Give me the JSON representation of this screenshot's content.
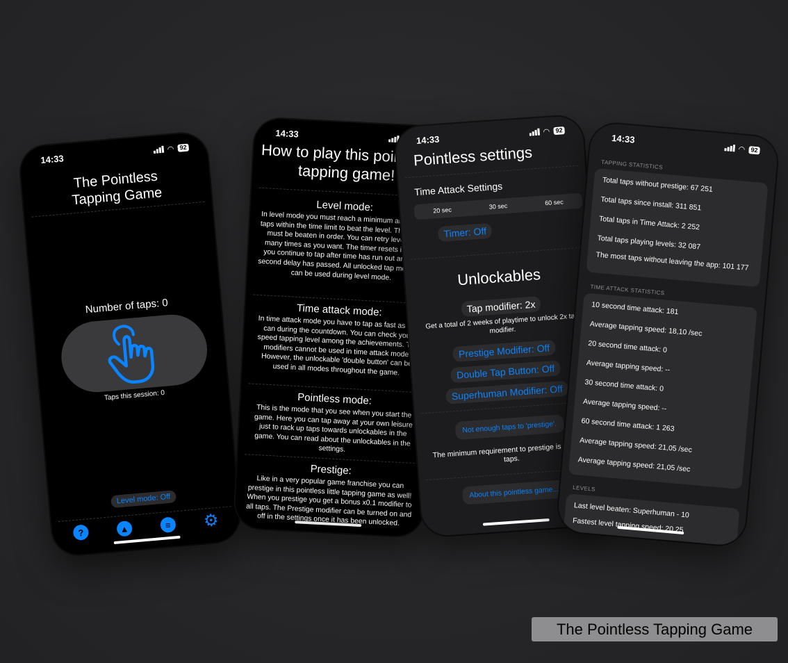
{
  "status": {
    "time": "14:33",
    "battery": "92"
  },
  "phone1": {
    "title_line1": "The Pointless",
    "title_line2": "Tapping Game",
    "taps_label": "Number of taps: 0",
    "session_label": "Taps this session: 0",
    "level_mode": "Level mode: Off",
    "tabs": [
      "help-icon",
      "thumbs-up-icon",
      "list-icon",
      "gear-icon"
    ]
  },
  "phone2": {
    "title_line1": "How to play this pointless",
    "title_line2": "tapping game!",
    "sections": [
      {
        "heading": "Level mode:",
        "body": "In level mode you must reach a minimum amount of taps within the time limit to beat the level. The levels must be beaten in order. You can retry levels as many times as you want. The timer resets itself if you continue to tap after time has run out and a 3 second delay has passed. All unlocked tap modifiers can be used during level mode."
      },
      {
        "heading": "Time attack mode:",
        "body": "In time attack mode you have to tap as fast as you can during the countdown. You can check your speed tapping level among the achievements. Tap modifiers cannot be used in time attack mode. However, the unlockable 'double button' can be used in all modes throughout the game."
      },
      {
        "heading": "Pointless mode:",
        "body": "This is the mode that you see when you start the game. Here you can tap away at your own leisure just to rack up taps towards unlockables in the game. You can read about the unlockables in the settings."
      },
      {
        "heading": "Prestige:",
        "body": "Like in a very popular game franchise you can prestige in this pointless little tapping game as well! When you prestige you get a bonus x0.1 modifier to all taps. The Prestige modifier can be turned on and off in the settings once it has been unlocked."
      }
    ]
  },
  "phone3": {
    "title": "Pointless settings",
    "time_attack_label": "Time Attack Settings",
    "segments": [
      "20 sec",
      "30 sec",
      "60 sec"
    ],
    "timer": "Timer: Off",
    "unlockables_title": "Unlockables",
    "tap_modifier": "Tap modifier: 2x",
    "tap_modifier_note": "Get a total of 2 weeks of playtime to unlock 2x tap modifier.",
    "prestige_modifier": "Prestige Modifier: Off",
    "double_tap": "Double Tap Button: Off",
    "superhuman": "Superhuman Modifier: Off",
    "prestige_button": "Not enough taps to 'prestige'.",
    "prestige_requirement": "The minimum requirement to prestige is 100,000 taps.",
    "about_button": "About this pointless game..."
  },
  "phone4": {
    "tapping_header": "TAPPING STATISTICS",
    "tapping_rows": [
      "Total taps without prestige: 67 251",
      "Total taps since install: 311 851",
      "Total taps in Time Attack: 2 252",
      "Total taps playing levels: 32 087",
      "The most taps without leaving the app: 101 177"
    ],
    "time_attack_header": "TIME ATTACK STATISTICS",
    "time_attack_rows": [
      "10 second time attack: 181",
      "Average tapping speed: 18,10 /sec",
      "20 second time attack: 0",
      "Average tapping speed: --",
      "30 second time attack: 0",
      "Average tapping speed: --",
      "60 second time attack: 1 263",
      "Average tapping speed: 21,05 /sec",
      "Average tapping speed: 21,05 /sec"
    ],
    "levels_header": "LEVELS",
    "levels_rows": [
      "Last level beaten: Superhuman - 10",
      "Fastest level tapping speed: 20,25"
    ]
  },
  "caption": "The Pointless Tapping Game"
}
